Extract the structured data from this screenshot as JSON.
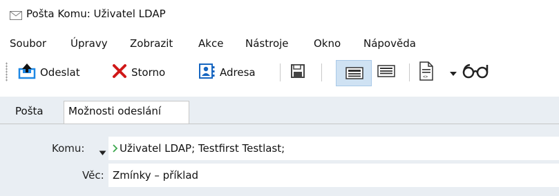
{
  "window": {
    "title": "Pošta Komu: Uživatel LDAP",
    "icon": "envelope-icon"
  },
  "menu": {
    "items": [
      "Soubor",
      "Úpravy",
      "Zobrazit",
      "Akce",
      "Nástroje",
      "Okno",
      "Nápověda"
    ]
  },
  "toolbar": {
    "send_label": "Odeslat",
    "send_icon": "send-tray-icon",
    "cancel_label": "Storno",
    "cancel_icon": "red-x-icon",
    "address_label": "Adresa",
    "address_icon": "address-book-icon",
    "save_icon": "save-disk-icon",
    "view_icons": [
      "compact-view-icon",
      "full-view-icon",
      "document-code-icon",
      "glasses-icon"
    ],
    "accent": "#1e88e5",
    "cancel_color": "#d01818",
    "toggle_bg": "#cfe2f3"
  },
  "tabs": [
    {
      "label": "Pošta",
      "active": true
    },
    {
      "label": "Možnosti odeslání",
      "active": false
    }
  ],
  "form": {
    "to_label": "Komu:",
    "to_value": "Uživatel LDAP;  Testfirst Testlast;",
    "subject_label": "Věc:",
    "subject_value": "Zmínky – příklad",
    "bg": "#e9eef3"
  }
}
